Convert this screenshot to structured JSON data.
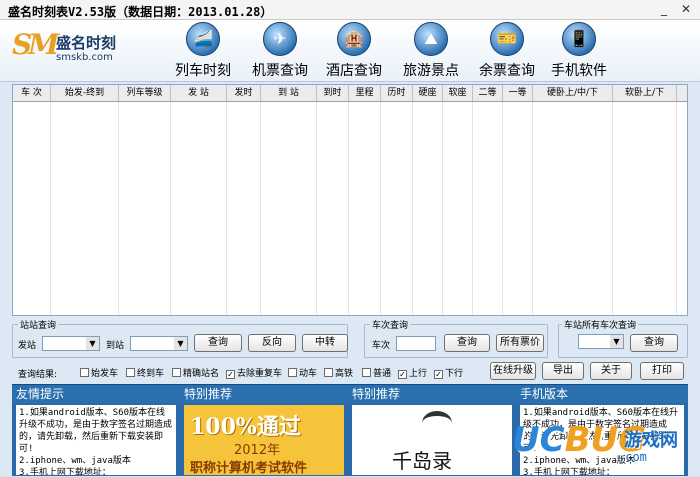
{
  "window": {
    "title": "盛名时刻表V2.53版（数据日期：2013.01.28）",
    "minimize": "_",
    "close": "✕"
  },
  "logo": {
    "mark": "SM",
    "name": "盛名时刻",
    "url": "smskb.com"
  },
  "nav": [
    {
      "label": "列车时刻",
      "icon": "train-icon"
    },
    {
      "label": "机票查询",
      "icon": "plane-icon"
    },
    {
      "label": "酒店查询",
      "icon": "hotel-icon"
    },
    {
      "label": "旅游景点",
      "icon": "scenic-icon"
    },
    {
      "label": "余票查询",
      "icon": "ticket-icon"
    },
    {
      "label": "手机软件",
      "icon": "phone-icon"
    }
  ],
  "table": {
    "columns": [
      "车 次",
      "始发-终到",
      "列车等级",
      "发 站",
      "发时",
      "到 站",
      "到时",
      "里程",
      "历时",
      "硬座",
      "软座",
      "二等",
      "一等",
      "硬卧上/中/下",
      "软卧上/下"
    ]
  },
  "station_query": {
    "legend": "站站查询",
    "from_label": "发站",
    "to_label": "到站",
    "query": "查询",
    "reverse": "反向",
    "transfer": "中转"
  },
  "train_query": {
    "legend": "车次查询",
    "train_label": "车次",
    "query": "查询",
    "all_prices": "所有票价"
  },
  "station_all": {
    "legend": "车站所有车次查询",
    "query": "查询"
  },
  "filters": {
    "label": "查询结果:",
    "items": [
      {
        "label": "始发车",
        "checked": false
      },
      {
        "label": "终到车",
        "checked": false
      },
      {
        "label": "精确站名",
        "checked": false
      },
      {
        "label": "去除重复车",
        "checked": true
      },
      {
        "label": "动车",
        "checked": false
      },
      {
        "label": "高铁",
        "checked": false
      },
      {
        "label": "普通",
        "checked": false
      },
      {
        "label": "上行",
        "checked": true
      },
      {
        "label": "下行",
        "checked": true
      }
    ]
  },
  "actions": {
    "upgrade": "在线升级",
    "export": "导出",
    "about": "关于",
    "print": "打印"
  },
  "bottom": {
    "tips_title": "友情提示",
    "tips_text": "1.如果android版本、S60版本在线升级不成功，是由于数字签名过期造成的，请先卸载，然后重新下载安装即可!\n2.iphone、wm、java版本\n3.手机上网下载地址：",
    "promo1_title": "特别推荐",
    "promo1_big": "100%通过",
    "promo1_year": "2012年",
    "promo1_sub": "职称计算机考试软件",
    "promo2_title": "特别推荐",
    "promo2_text": "千岛录",
    "mobile_title": "手机版本",
    "mobile_text": "1.如果android版本、S60版本在线升级不成功，是由于数字签名过期造成的，请先卸载，然后重新下载安装即可!\n2.iphone、wm、java版本\n3.手机上网下载地址："
  },
  "watermark": {
    "brand_a": "UC",
    "brand_b": "BUG",
    "cn": "游戏网",
    "domain": ".com"
  }
}
